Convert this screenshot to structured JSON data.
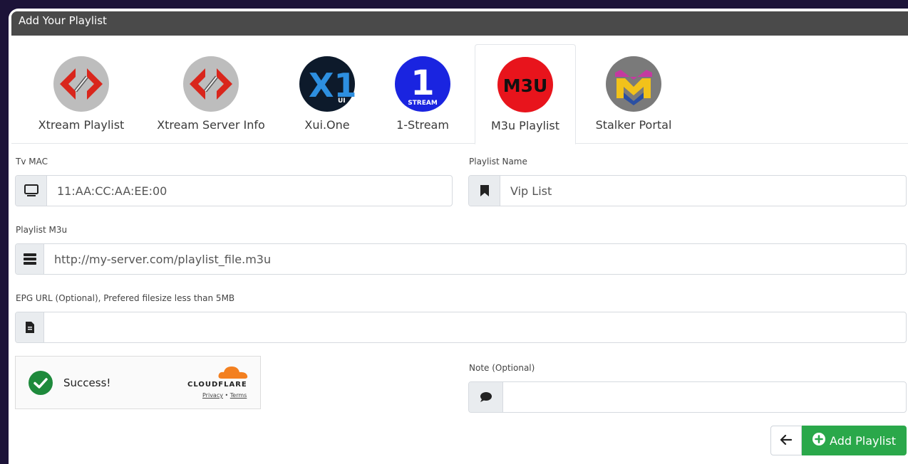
{
  "window": {
    "title": "Add Your Playlist"
  },
  "tabs": [
    {
      "label": "Xtream Playlist",
      "icon": "xtream-code-icon"
    },
    {
      "label": "Xtream Server Info",
      "icon": "xtream-code-icon"
    },
    {
      "label": "Xui.One",
      "icon": "xui-one-logo",
      "logo_text": "X1",
      "logo_sub": "UI"
    },
    {
      "label": "1-Stream",
      "icon": "one-stream-logo",
      "logo_text": "1",
      "logo_sub": "STREAM"
    },
    {
      "label": "M3u Playlist",
      "icon": "m3u-logo",
      "logo_text": "M3U",
      "active": true
    },
    {
      "label": "Stalker Portal",
      "icon": "stalker-logo"
    }
  ],
  "form": {
    "tv_mac": {
      "label": "Tv MAC",
      "value": "11:AA:CC:AA:EE:00",
      "icon": "monitor-icon"
    },
    "playlist_name": {
      "label": "Playlist Name",
      "value": "Vip List",
      "icon": "bookmark-icon"
    },
    "playlist_m3u": {
      "label": "Playlist M3u",
      "value": "http://my-server.com/playlist_file.m3u",
      "icon": "server-icon"
    },
    "epg_url": {
      "label": "EPG URL (Optional), Prefered filesize less than 5MB",
      "value": "",
      "icon": "file-icon"
    },
    "note": {
      "label": "Note (Optional)",
      "value": "",
      "icon": "comment-icon"
    }
  },
  "captcha": {
    "status": "Success!",
    "brand": "CLOUDFLARE",
    "privacy": "Privacy",
    "separator": "•",
    "terms": "Terms"
  },
  "actions": {
    "back_icon": "arrow-left-icon",
    "add_label": "Add Playlist",
    "add_icon": "plus-circle-icon"
  },
  "colors": {
    "background": "#1c1338",
    "titlebar": "#4a4a4a",
    "success_green": "#2aa84a",
    "m3u_red": "#e8141c",
    "one_stream_blue": "#1a24e0",
    "cloudflare_orange": "#f38020"
  }
}
